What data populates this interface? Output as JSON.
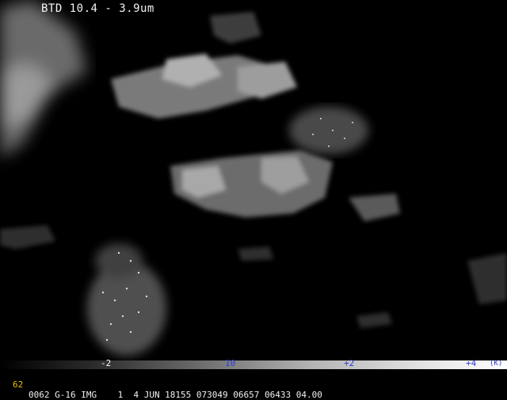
{
  "title": "BTD 10.4 - 3.9um",
  "colorbar": {
    "ticks": [
      "-2",
      "10",
      "+2",
      "+4"
    ],
    "unit": "(K)"
  },
  "status": {
    "frame": "62",
    "text": "0062 G-16 IMG    1  4 JUN 18155 073049 06657 06433 04.00"
  },
  "colors": {
    "background": "#000000",
    "title_text": "#f2f2f2",
    "tick_blue": "#2a3ad8",
    "frame_yellow": "#e6c000"
  }
}
